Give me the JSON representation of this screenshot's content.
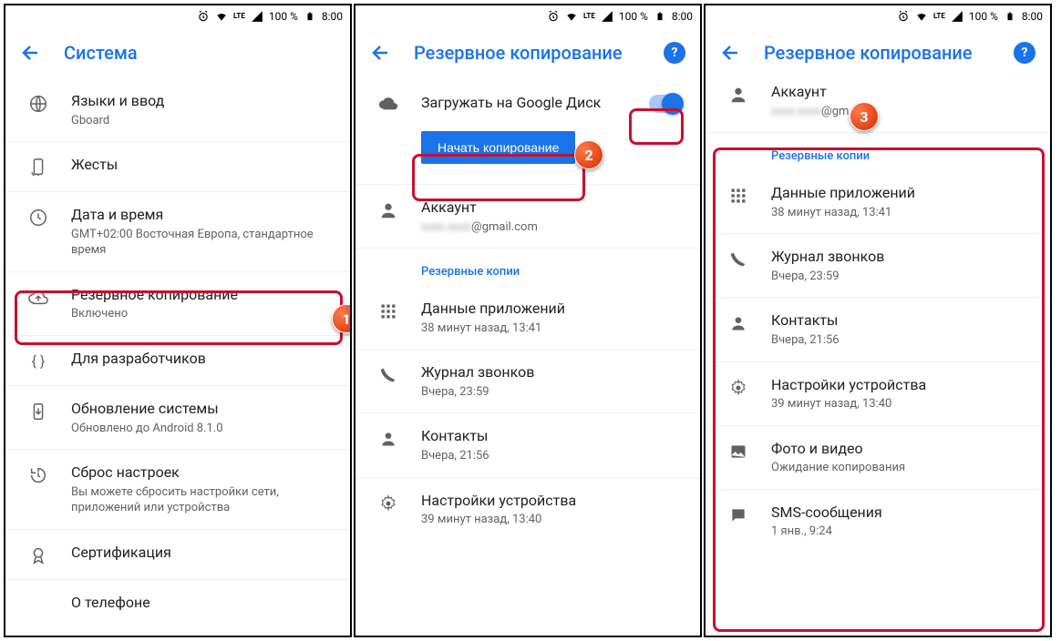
{
  "status": {
    "percent": "100 %",
    "time": "8:00",
    "net": "LTE"
  },
  "p1": {
    "title": "Система",
    "items": [
      {
        "title": "Языки и ввод",
        "sub": "Gboard"
      },
      {
        "title": "Жесты",
        "sub": ""
      },
      {
        "title": "Дата и время",
        "sub": "GMT+02:00 Восточная Европа, стандартное время"
      },
      {
        "title": "Резервное копирование",
        "sub": "Включено"
      },
      {
        "title": "Для разработчиков",
        "sub": ""
      },
      {
        "title": "Обновление системы",
        "sub": "Обновлено до Android 8.1.0"
      },
      {
        "title": "Сброс настроек",
        "sub": "Вы можете сбросить настройки сети, приложений или устройства"
      },
      {
        "title": "Сертификация",
        "sub": ""
      },
      {
        "title": "О телефоне",
        "sub": ""
      }
    ]
  },
  "p2": {
    "title": "Резервное копирование",
    "upload": "Загружать на Google Диск",
    "start_btn": "Начать копирование",
    "account_label": "Аккаунт",
    "account_value": "@gmail.com",
    "section": "Резервные копии",
    "items": [
      {
        "title": "Данные приложений",
        "sub": "38 минут назад, 13:41"
      },
      {
        "title": "Журнал звонков",
        "sub": "Вчера, 23:59"
      },
      {
        "title": "Контакты",
        "sub": "Вчера, 21:56"
      },
      {
        "title": "Настройки устройства",
        "sub": "39 минут назад, 13:40"
      }
    ]
  },
  "p3": {
    "title": "Резервное копирование",
    "account_label": "Аккаунт",
    "account_value": "@gm",
    "section": "Резервные копии",
    "items": [
      {
        "title": "Данные приложений",
        "sub": "38 минут назад, 13:41"
      },
      {
        "title": "Журнал звонков",
        "sub": "Вчера, 23:59"
      },
      {
        "title": "Контакты",
        "sub": "Вчера, 21:56"
      },
      {
        "title": "Настройки устройства",
        "sub": "39 минут назад, 13:40"
      },
      {
        "title": "Фото и видео",
        "sub": "Ожидание копирования"
      },
      {
        "title": "SMS-сообщения",
        "sub": "1 янв., 9:24"
      }
    ]
  },
  "markers": {
    "m1": "1",
    "m2": "2",
    "m3": "3"
  }
}
